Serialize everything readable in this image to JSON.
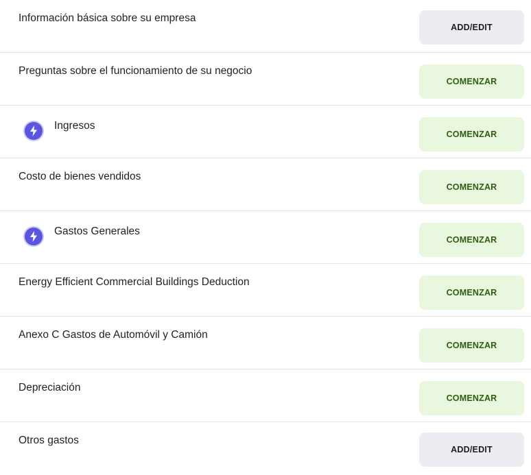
{
  "colors": {
    "start_button_bg": "#e9f7de",
    "start_button_text": "#2e5d12",
    "edit_button_bg": "#ebedf2",
    "icon_accent": "#5b55e0",
    "divider": "#e3e3e3"
  },
  "sections": [
    {
      "title": "Información básica sobre su empresa",
      "button": "ADD/EDIT",
      "icon": null
    },
    {
      "title": "Preguntas sobre el funcionamiento de su negocio",
      "button": "COMENZAR",
      "icon": null
    },
    {
      "title": "Ingresos",
      "button": "COMENZAR",
      "icon": "lightning-bolt-icon"
    },
    {
      "title": "Costo de bienes vendidos",
      "button": "COMENZAR",
      "icon": null
    },
    {
      "title": "Gastos Generales",
      "button": "COMENZAR",
      "icon": "lightning-bolt-icon"
    },
    {
      "title": "Energy Efficient Commercial Buildings Deduction",
      "button": "COMENZAR",
      "icon": null
    },
    {
      "title": "Anexo C Gastos de Automóvil y Camión",
      "button": "COMENZAR",
      "icon": null
    },
    {
      "title": "Depreciación",
      "button": "COMENZAR",
      "icon": null
    },
    {
      "title": "Otros gastos",
      "button": "ADD/EDIT",
      "icon": null
    }
  ]
}
